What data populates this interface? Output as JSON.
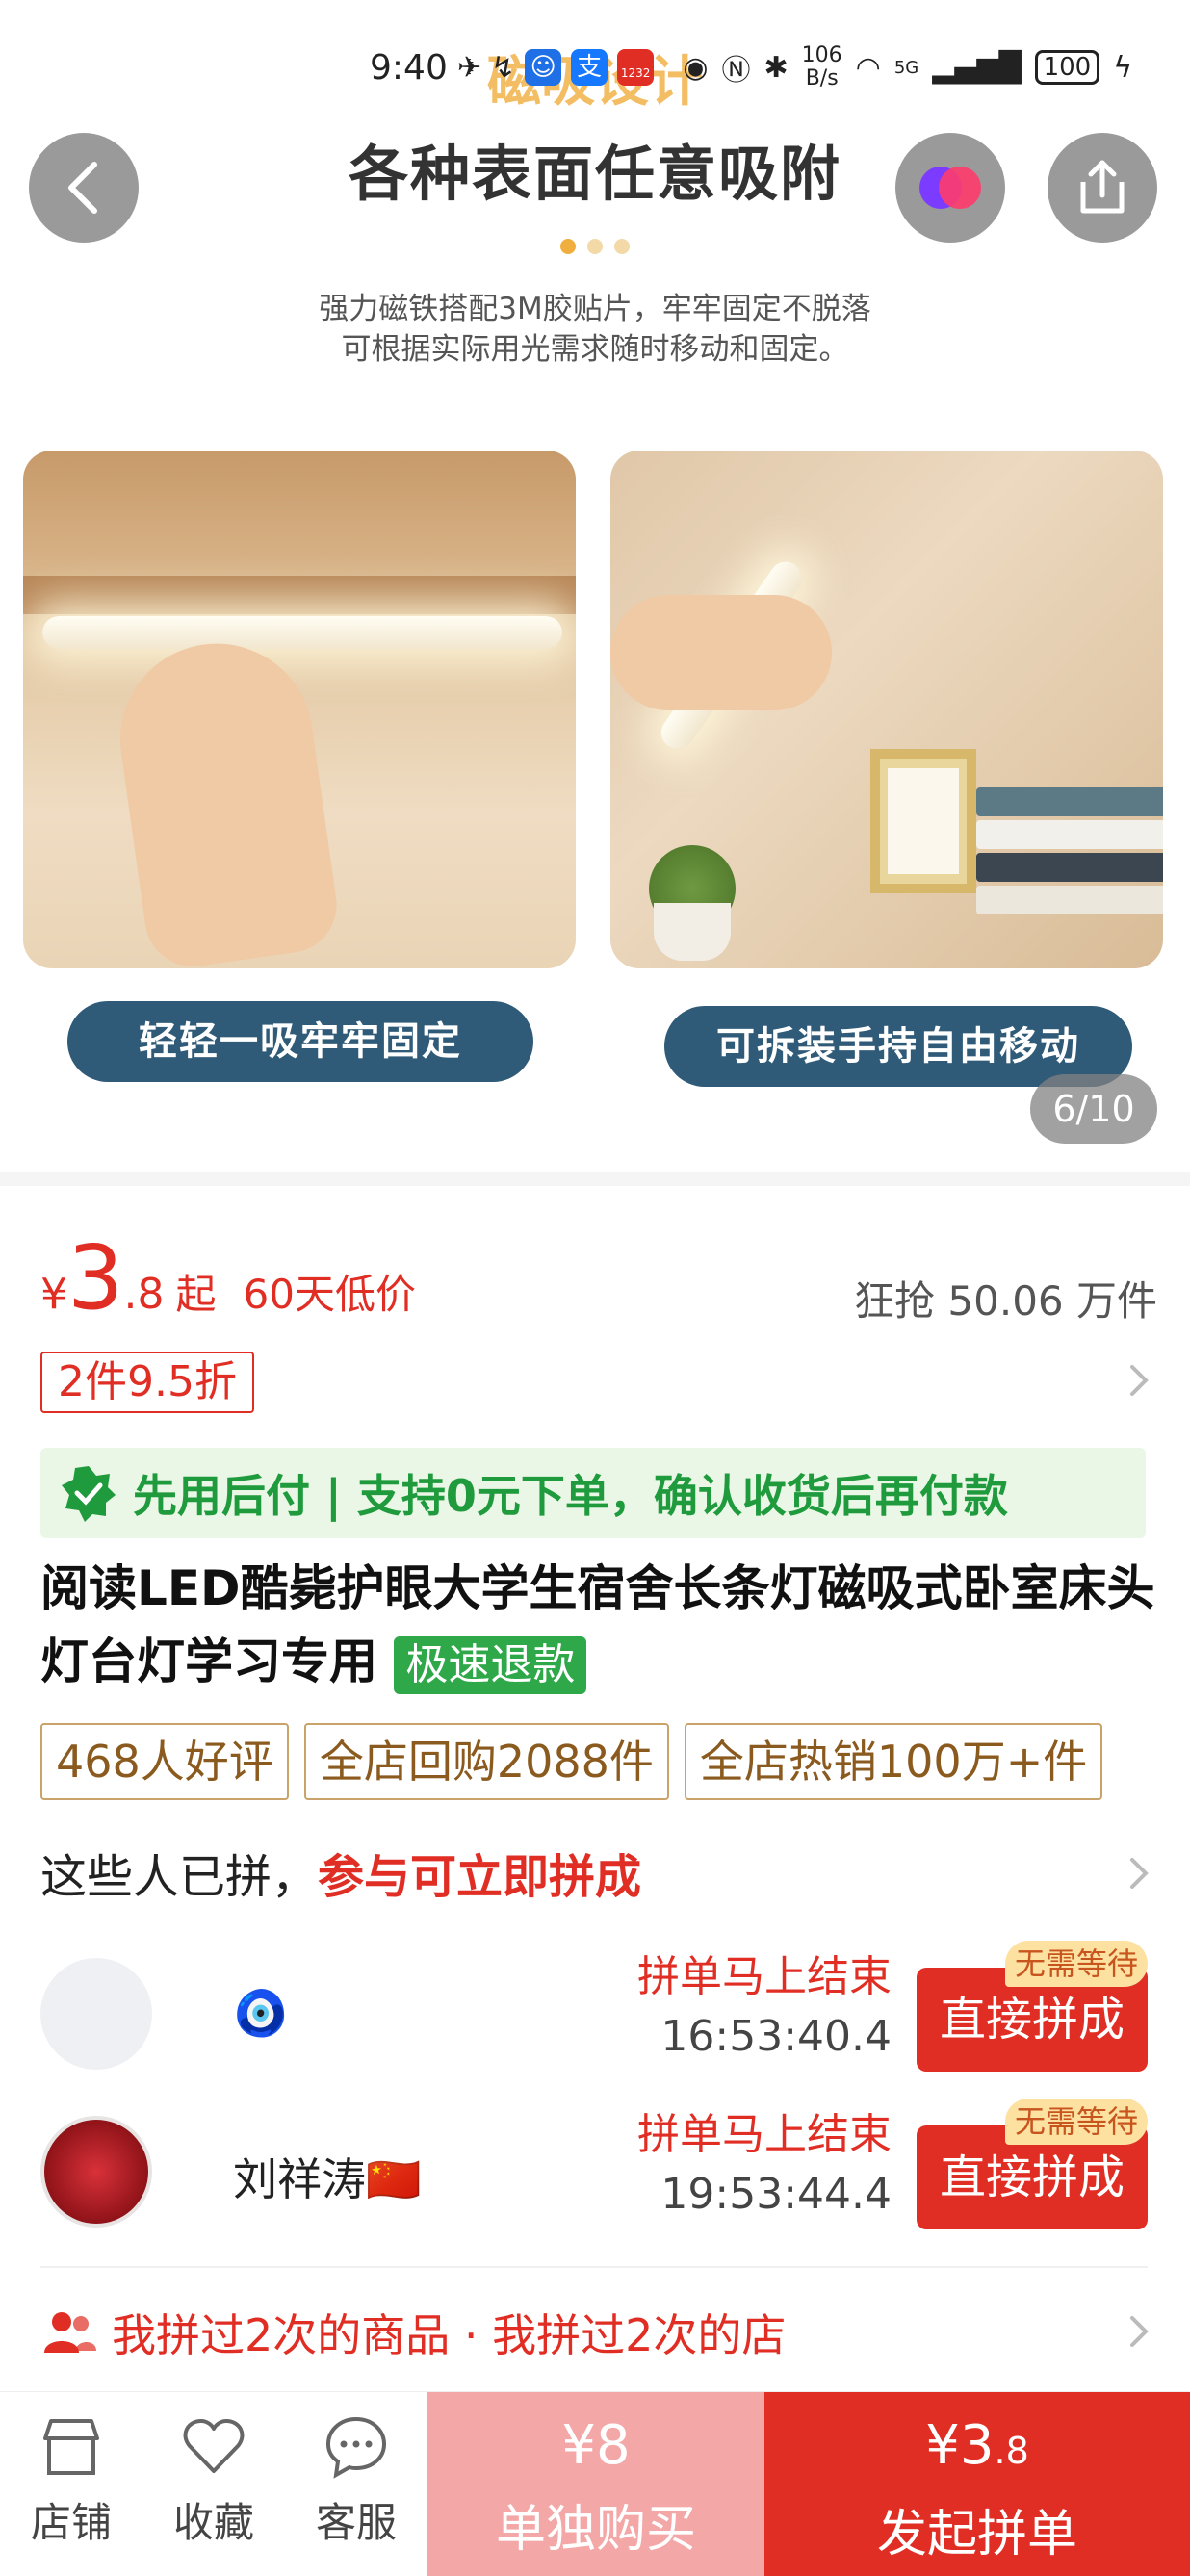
{
  "status_bar": {
    "time": "9:40",
    "app_badge": "1232",
    "net_speed_value": "106",
    "net_speed_unit": "B/s",
    "network": "5G",
    "battery": "100"
  },
  "gallery": {
    "ghost_title": "磁吸设计",
    "title": "各种表面任意吸附",
    "description_line1": "强力磁铁搭配3M胶贴片，牢牢固定不脱落",
    "description_line2": "可根据实际用光需求随时移动和固定。",
    "caption_left": "轻轻一吸牢牢固定",
    "caption_right": "可拆装手持自由移动",
    "counter": "6/10"
  },
  "price": {
    "symbol": "¥",
    "integer": "3",
    "decimal": ".8",
    "suffix": "起",
    "low_price_label": "60天低价",
    "sold": "狂抢 50.06 万件"
  },
  "discount": {
    "tag": "2件9.5折"
  },
  "paylater": {
    "text": "先用后付 | 支持0元下单，确认收货后再付款"
  },
  "product": {
    "title": "阅读LED酷毙护眼大学生宿舍长条灯磁吸式卧室床头灯台灯学习专用",
    "refund_tag": "极速退款"
  },
  "tags": [
    "468人好评",
    "全店回购2088件",
    "全店热销100万+件"
  ],
  "group_buy": {
    "header_normal": "这些人已拼，",
    "header_highlight": "参与可立即拼成",
    "rows": [
      {
        "name": "🧿",
        "ending": "拼单马上结束",
        "time": "16:53:40.4",
        "badge": "无需等待",
        "button": "直接拼成"
      },
      {
        "name": "刘祥涛🇨🇳",
        "ending": "拼单马上结束",
        "time": "19:53:44.4",
        "badge": "无需等待",
        "button": "直接拼成"
      }
    ]
  },
  "history": {
    "text": "我拼过2次的商品 · 我拼过2次的店"
  },
  "bottom_bar": {
    "store": "店铺",
    "favorite": "收藏",
    "service": "客服",
    "buy_alone_price": "¥8",
    "buy_alone_label": "单独购买",
    "group_price_int": "¥3",
    "group_price_dec": ".8",
    "group_label": "发起拼单"
  },
  "colors": {
    "accent_red": "#e02e24",
    "paylater_green": "#1f9b3d",
    "caption_blue": "#2f5a78"
  }
}
